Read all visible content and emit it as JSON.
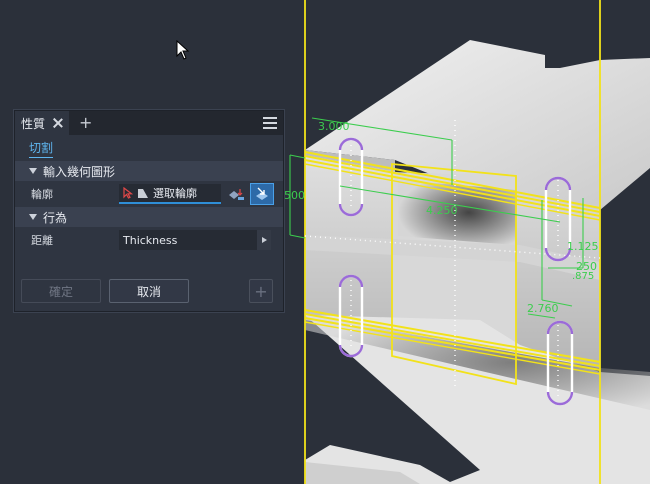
{
  "panel": {
    "tab_label": "性質",
    "subtab_label": "切割",
    "section_input": "輸入幾何圖形",
    "profile_label": "輪廓",
    "profile_value": "選取輪廓",
    "section_behavior": "行為",
    "distance_label": "距離",
    "distance_value": "Thickness",
    "ok_label": "確定",
    "cancel_label": "取消",
    "plus_label": "+"
  },
  "dimensions": {
    "d1": "3.000",
    "d2": "500",
    "d3": "4.250",
    "d4": "1.125",
    "d5": "250",
    "d6": ".875",
    "d7": "2.760"
  },
  "colors": {
    "background": "#2b303a",
    "accent": "#2f8fd8",
    "dimension": "#3ccd4e",
    "highlight": "#f2e21a",
    "slot": "#9b6bd8"
  }
}
